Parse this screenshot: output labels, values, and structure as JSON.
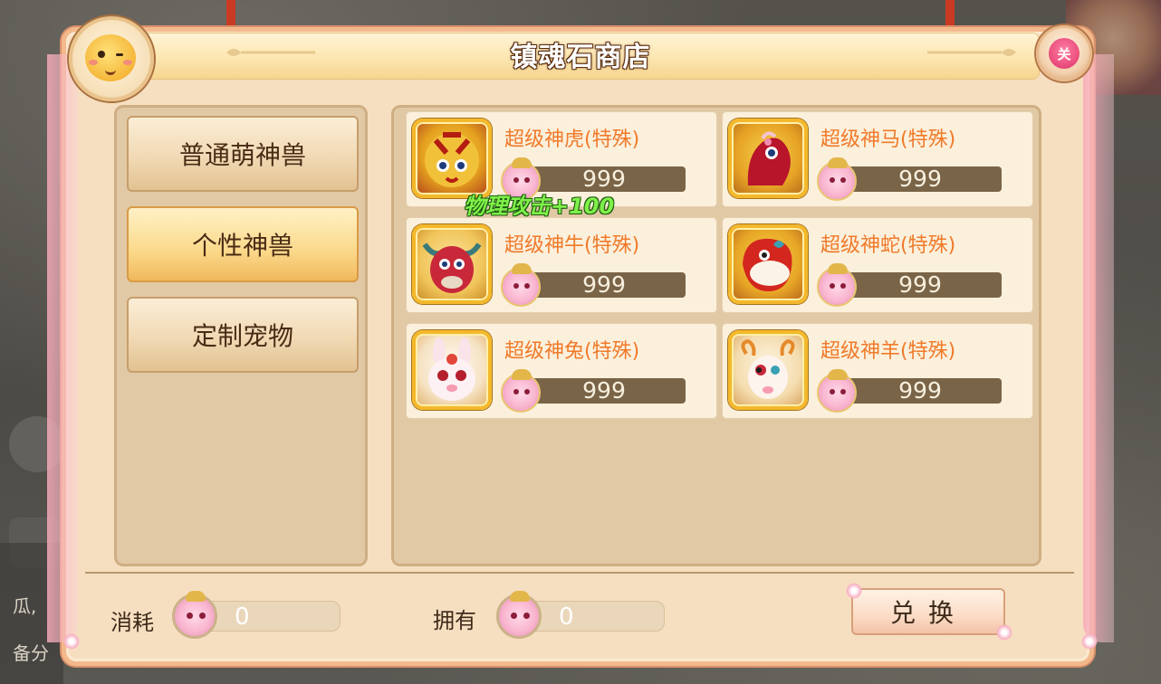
{
  "window": {
    "title": "镇魂石商店",
    "close_label": "关"
  },
  "categories": [
    {
      "label": "普通萌神兽",
      "active": false
    },
    {
      "label": "个性神兽",
      "active": true
    },
    {
      "label": "定制宠物",
      "active": false
    }
  ],
  "items": [
    {
      "name": "超级神虎(特殊)",
      "price": "999",
      "icon": "tiger-icon"
    },
    {
      "name": "超级神马(特殊)",
      "price": "999",
      "icon": "horse-icon"
    },
    {
      "name": "超级神牛(特殊)",
      "price": "999",
      "icon": "ox-icon"
    },
    {
      "name": "超级神蛇(特殊)",
      "price": "999",
      "icon": "snake-icon"
    },
    {
      "name": "超级神兔(特殊)",
      "price": "999",
      "icon": "rabbit-icon"
    },
    {
      "name": "超级神羊(特殊)",
      "price": "999",
      "icon": "sheep-icon"
    }
  ],
  "floating_tip": "物理攻击+100",
  "footer": {
    "consume_label": "消耗",
    "consume_value": "0",
    "own_label": "拥有",
    "own_value": "0",
    "exchange_label": "兑换"
  },
  "background": {
    "left_text_1": "瓜,",
    "left_text_2": "备分"
  }
}
